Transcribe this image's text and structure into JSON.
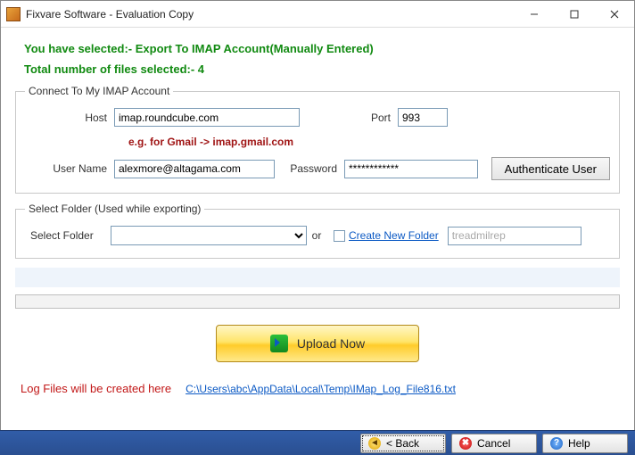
{
  "window": {
    "title": "Fixvare Software - Evaluation Copy"
  },
  "header": {
    "selection_line": "You have selected:- Export To IMAP Account(Manually Entered)",
    "files_line": "Total number of files selected:- 4"
  },
  "imap_group": {
    "legend": "Connect To My IMAP Account",
    "host_label": "Host",
    "host_value": "imap.roundcube.com",
    "port_label": "Port",
    "port_value": "993",
    "hint": "e.g. for Gmail -> imap.gmail.com",
    "user_label": "User Name",
    "user_value": "alexmore@altagama.com",
    "password_label": "Password",
    "password_value": "************",
    "auth_button": "Authenticate User"
  },
  "folder_group": {
    "legend": "Select Folder (Used while exporting)",
    "select_label": "Select Folder",
    "select_value": "",
    "or_label": "or",
    "create_label": "Create New Folder",
    "new_folder_value": "treadmilrep",
    "create_checked": false
  },
  "upload": {
    "button_label": "Upload Now"
  },
  "log": {
    "label": "Log Files will be created here",
    "path": "C:\\Users\\abc\\AppData\\Local\\Temp\\IMap_Log_File816.txt"
  },
  "bottom": {
    "back": "< Back",
    "cancel": "Cancel",
    "help": "Help"
  }
}
